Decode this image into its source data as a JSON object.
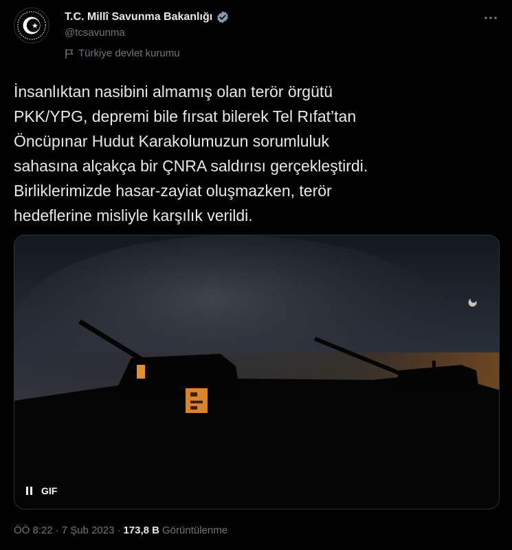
{
  "author": {
    "display_name": "T.C. Millî Savunma Bakanlığı",
    "handle": "@tcsavunma",
    "affiliation": "Türkiye devlet kurumu",
    "avatar_icon": "ministry-emblem-icon",
    "verified_icon": "verified-badge-icon"
  },
  "tweet": {
    "text": "İnsanlıktan nasibini almamış olan terör örgütü\nPKK/YPG, depremi bile fırsat bilerek Tel Rıfat’tan\nÖncüpınar Hudut Karakolumuzun sorumluluk\nsahasına alçakça bir ÇNRA saldırısı gerçekleştirdi.\nBirliklerimizde hasar-zayiat oluşmazken, terör\nhedeflerine misliyle karşılık verildi."
  },
  "media": {
    "type": "gif",
    "badge_label": "GIF",
    "pause_icon": "pause-icon"
  },
  "meta": {
    "time": "ÖÖ 8:22",
    "separator": "·",
    "date": "7 Şub 2023",
    "views_count": "173,8 B",
    "views_label": "Görüntülenme"
  },
  "colors": {
    "background": "#000000",
    "text": "#e7e9ea",
    "muted": "#71767b",
    "verified": "#829aab"
  }
}
